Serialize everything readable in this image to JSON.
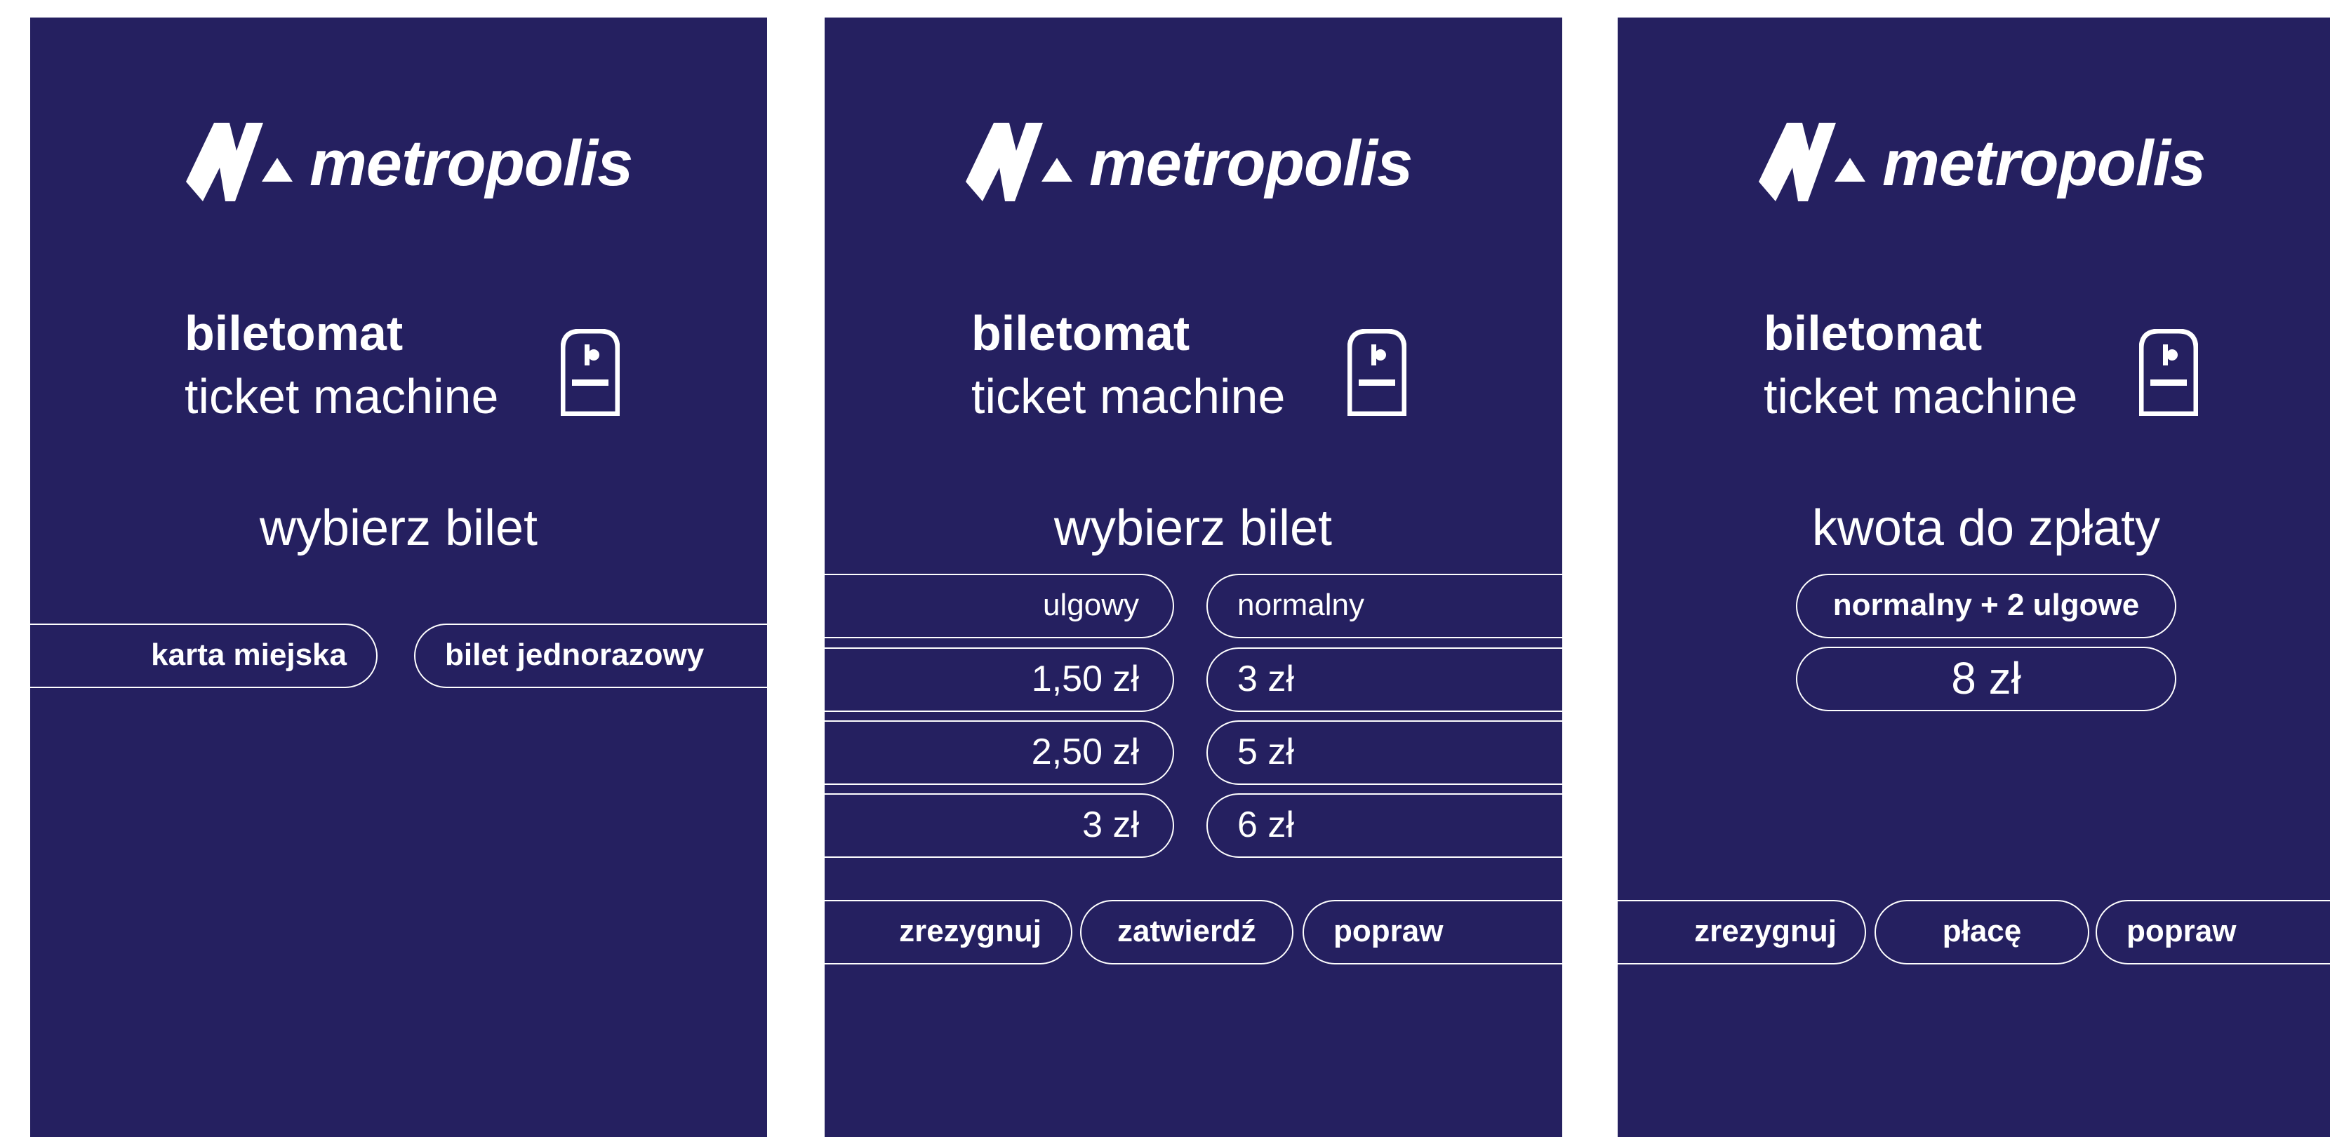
{
  "brand": {
    "name": "metropolis"
  },
  "header": {
    "title": "biletomat",
    "subtitle": "ticket machine"
  },
  "colors": {
    "panel": "#252060",
    "foreground": "#ffffff",
    "page": "#ffffff"
  },
  "icons": {
    "logo": "metropolis-logo-mark",
    "machine": "ticket-machine-icon"
  },
  "screen1": {
    "prompt": "wybierz bilet",
    "options": [
      {
        "label": "karta miejska"
      },
      {
        "label": "bilet jednorazowy"
      }
    ]
  },
  "screen2": {
    "prompt": "wybierz bilet",
    "columns": [
      {
        "header": "ulgowy",
        "prices": [
          "1,50 zł",
          "2,50 zł",
          "3 zł"
        ]
      },
      {
        "header": "normalny",
        "prices": [
          "3 zł",
          "5 zł",
          "6 zł"
        ]
      }
    ],
    "actions": {
      "cancel": "zrezygnuj",
      "confirm": "zatwierdź",
      "correct": "popraw"
    }
  },
  "screen3": {
    "prompt": "kwota do zpłaty",
    "summary": "normalny + 2 ulgowe",
    "total": "8 zł",
    "actions": {
      "cancel": "zrezygnuj",
      "pay": "płacę",
      "correct": "popraw"
    }
  }
}
